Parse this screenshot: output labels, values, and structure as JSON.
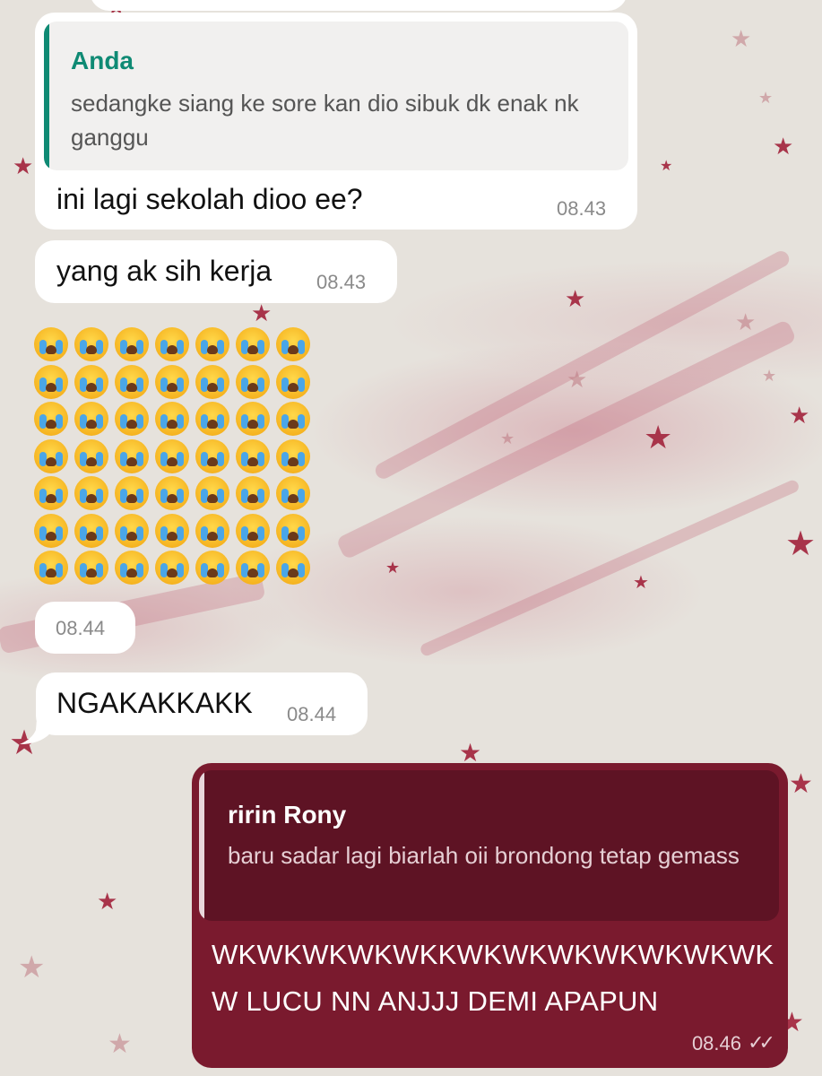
{
  "messages": [
    {
      "reply_to": {
        "name": "Anda",
        "text": "sedangke siang ke sore kan dio sibuk dk enak nk ganggu"
      },
      "text": "ini lagi sekolah dioo ee?",
      "time": "08.43"
    },
    {
      "text": "yang ak sih kerja",
      "time": "08.43"
    },
    {
      "emoji": "loudly-crying-face",
      "emoji_count": 49,
      "time": "08.44"
    },
    {
      "text": "NGAKAKKAKK",
      "time": "08.44"
    }
  ],
  "outgoing": {
    "reply_to": {
      "name": "ririn Rony",
      "text": "baru sadar lagi biarlah oii brondong tetap gemass"
    },
    "text": "WKWKWKWKWKKWKWKWKWKWKWKWKW LUCU NN ANJJJ DEMI APAPUN",
    "time": "08.46",
    "status_icon": "double-check-icon"
  },
  "colors": {
    "incoming_bubble": "#ffffff",
    "outgoing_bubble": "#7a1a2e",
    "quote_accent": "#0f8a74"
  }
}
